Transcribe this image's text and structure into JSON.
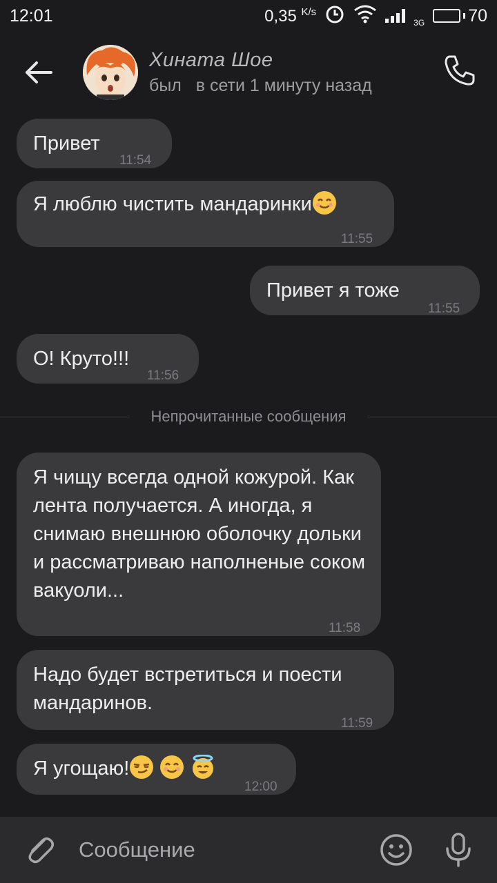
{
  "status_bar": {
    "time": "12:01",
    "net_speed": "0,35",
    "net_unit": "K/s",
    "net_type": "3G",
    "battery_level": 70,
    "battery_text": "70",
    "icons": [
      "alarm-icon",
      "wifi-icon",
      "signal-icon",
      "battery-icon"
    ]
  },
  "header": {
    "contact_name": "Хината Шое",
    "contact_status": "был   в сети 1 минуту назад",
    "icons": [
      "back-arrow-icon",
      "avatar",
      "phone-icon"
    ]
  },
  "messages": [
    {
      "text": "Привет",
      "time": "11:54",
      "direction": "incoming"
    },
    {
      "text": "Я люблю чистить мандаринки",
      "time": "11:55",
      "direction": "incoming",
      "emojis": [
        "smiling-face-icon"
      ]
    },
    {
      "text": "Привет я тоже",
      "time": "11:55",
      "direction": "outgoing"
    },
    {
      "text": "О! Круто!!!",
      "time": "11:56",
      "direction": "incoming"
    },
    {
      "text": "Я чищу всегда одной кожурой. Как лента получается. А иногда, я снимаю внешнюю оболочку дольки и рассматриваю наполненые соком вакуоли...",
      "time": "11:58",
      "direction": "incoming"
    },
    {
      "text": "Надо будет встретиться и поести мандаринов.",
      "time": "11:59",
      "direction": "incoming"
    },
    {
      "text": "Я угощаю!",
      "time": "12:00",
      "direction": "incoming",
      "emojis": [
        "smirking-face-icon",
        "smiling-face-icon",
        "halo-face-icon"
      ]
    }
  ],
  "divider": {
    "label": "Непрочитанные сообщения"
  },
  "composer": {
    "placeholder": "Сообщение",
    "icons": [
      "paperclip-icon",
      "emoji-icon",
      "microphone-icon"
    ]
  },
  "colors": {
    "background": "#1b1b1d",
    "bubble": "#3a3a3c",
    "composer": "#2b2b2e",
    "emoji": "#f7c646"
  }
}
